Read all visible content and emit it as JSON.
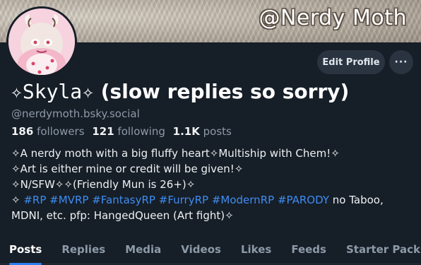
{
  "banner": {
    "watermark_text": "@Nerdy Moth"
  },
  "avatar": {
    "description_icon": "moth-character-avatar"
  },
  "actions": {
    "edit_profile_label": "Edit Profile",
    "more_label": "···"
  },
  "profile": {
    "display_name_deco": "✧Skyla✧",
    "display_name_rest": " (slow replies so sorry)",
    "handle": "@nerdymoth.bsky.social",
    "followers_count": "186",
    "followers_label": "followers",
    "following_count": "121",
    "following_label": "following",
    "posts_count": "1.1K",
    "posts_label": "posts"
  },
  "bio": {
    "line1": "✧A nerdy moth with a big fluffy heart✧Multiship with Chem!✧",
    "line2": "✧Art is either mine or credit will be given!✧",
    "line3": "✧N/SFW✧✧(Friendly Mun is 26+)✧",
    "line4_prefix": "✧ ",
    "tags": [
      "#RP",
      "#MVRP",
      "#FantasyRP",
      "#FurryRP",
      "#ModernRP",
      "#PARODY"
    ],
    "line4_suffix": " no Taboo,",
    "line5": "MDNI, etc. pfp: HangedQueen (Art fight)✧"
  },
  "tabs": [
    {
      "label": "Posts",
      "active": true
    },
    {
      "label": "Replies",
      "active": false
    },
    {
      "label": "Media",
      "active": false
    },
    {
      "label": "Videos",
      "active": false
    },
    {
      "label": "Likes",
      "active": false
    },
    {
      "label": "Feeds",
      "active": false
    },
    {
      "label": "Starter Packs",
      "active": false
    }
  ],
  "colors": {
    "background": "#161e27",
    "accent": "#2b7ff0",
    "tag": "#3f8df2",
    "muted": "#8d9aa8"
  }
}
